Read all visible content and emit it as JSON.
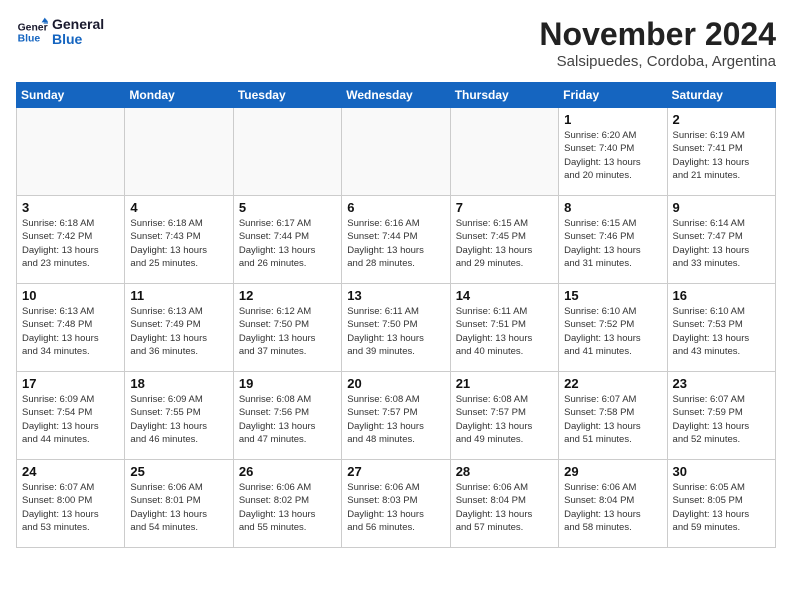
{
  "header": {
    "logo_line1": "General",
    "logo_line2": "Blue",
    "month_title": "November 2024",
    "location": "Salsipuedes, Cordoba, Argentina"
  },
  "days_of_week": [
    "Sunday",
    "Monday",
    "Tuesday",
    "Wednesday",
    "Thursday",
    "Friday",
    "Saturday"
  ],
  "weeks": [
    [
      {
        "day": "",
        "info": ""
      },
      {
        "day": "",
        "info": ""
      },
      {
        "day": "",
        "info": ""
      },
      {
        "day": "",
        "info": ""
      },
      {
        "day": "",
        "info": ""
      },
      {
        "day": "1",
        "info": "Sunrise: 6:20 AM\nSunset: 7:40 PM\nDaylight: 13 hours\nand 20 minutes."
      },
      {
        "day": "2",
        "info": "Sunrise: 6:19 AM\nSunset: 7:41 PM\nDaylight: 13 hours\nand 21 minutes."
      }
    ],
    [
      {
        "day": "3",
        "info": "Sunrise: 6:18 AM\nSunset: 7:42 PM\nDaylight: 13 hours\nand 23 minutes."
      },
      {
        "day": "4",
        "info": "Sunrise: 6:18 AM\nSunset: 7:43 PM\nDaylight: 13 hours\nand 25 minutes."
      },
      {
        "day": "5",
        "info": "Sunrise: 6:17 AM\nSunset: 7:44 PM\nDaylight: 13 hours\nand 26 minutes."
      },
      {
        "day": "6",
        "info": "Sunrise: 6:16 AM\nSunset: 7:44 PM\nDaylight: 13 hours\nand 28 minutes."
      },
      {
        "day": "7",
        "info": "Sunrise: 6:15 AM\nSunset: 7:45 PM\nDaylight: 13 hours\nand 29 minutes."
      },
      {
        "day": "8",
        "info": "Sunrise: 6:15 AM\nSunset: 7:46 PM\nDaylight: 13 hours\nand 31 minutes."
      },
      {
        "day": "9",
        "info": "Sunrise: 6:14 AM\nSunset: 7:47 PM\nDaylight: 13 hours\nand 33 minutes."
      }
    ],
    [
      {
        "day": "10",
        "info": "Sunrise: 6:13 AM\nSunset: 7:48 PM\nDaylight: 13 hours\nand 34 minutes."
      },
      {
        "day": "11",
        "info": "Sunrise: 6:13 AM\nSunset: 7:49 PM\nDaylight: 13 hours\nand 36 minutes."
      },
      {
        "day": "12",
        "info": "Sunrise: 6:12 AM\nSunset: 7:50 PM\nDaylight: 13 hours\nand 37 minutes."
      },
      {
        "day": "13",
        "info": "Sunrise: 6:11 AM\nSunset: 7:50 PM\nDaylight: 13 hours\nand 39 minutes."
      },
      {
        "day": "14",
        "info": "Sunrise: 6:11 AM\nSunset: 7:51 PM\nDaylight: 13 hours\nand 40 minutes."
      },
      {
        "day": "15",
        "info": "Sunrise: 6:10 AM\nSunset: 7:52 PM\nDaylight: 13 hours\nand 41 minutes."
      },
      {
        "day": "16",
        "info": "Sunrise: 6:10 AM\nSunset: 7:53 PM\nDaylight: 13 hours\nand 43 minutes."
      }
    ],
    [
      {
        "day": "17",
        "info": "Sunrise: 6:09 AM\nSunset: 7:54 PM\nDaylight: 13 hours\nand 44 minutes."
      },
      {
        "day": "18",
        "info": "Sunrise: 6:09 AM\nSunset: 7:55 PM\nDaylight: 13 hours\nand 46 minutes."
      },
      {
        "day": "19",
        "info": "Sunrise: 6:08 AM\nSunset: 7:56 PM\nDaylight: 13 hours\nand 47 minutes."
      },
      {
        "day": "20",
        "info": "Sunrise: 6:08 AM\nSunset: 7:57 PM\nDaylight: 13 hours\nand 48 minutes."
      },
      {
        "day": "21",
        "info": "Sunrise: 6:08 AM\nSunset: 7:57 PM\nDaylight: 13 hours\nand 49 minutes."
      },
      {
        "day": "22",
        "info": "Sunrise: 6:07 AM\nSunset: 7:58 PM\nDaylight: 13 hours\nand 51 minutes."
      },
      {
        "day": "23",
        "info": "Sunrise: 6:07 AM\nSunset: 7:59 PM\nDaylight: 13 hours\nand 52 minutes."
      }
    ],
    [
      {
        "day": "24",
        "info": "Sunrise: 6:07 AM\nSunset: 8:00 PM\nDaylight: 13 hours\nand 53 minutes."
      },
      {
        "day": "25",
        "info": "Sunrise: 6:06 AM\nSunset: 8:01 PM\nDaylight: 13 hours\nand 54 minutes."
      },
      {
        "day": "26",
        "info": "Sunrise: 6:06 AM\nSunset: 8:02 PM\nDaylight: 13 hours\nand 55 minutes."
      },
      {
        "day": "27",
        "info": "Sunrise: 6:06 AM\nSunset: 8:03 PM\nDaylight: 13 hours\nand 56 minutes."
      },
      {
        "day": "28",
        "info": "Sunrise: 6:06 AM\nSunset: 8:04 PM\nDaylight: 13 hours\nand 57 minutes."
      },
      {
        "day": "29",
        "info": "Sunrise: 6:06 AM\nSunset: 8:04 PM\nDaylight: 13 hours\nand 58 minutes."
      },
      {
        "day": "30",
        "info": "Sunrise: 6:05 AM\nSunset: 8:05 PM\nDaylight: 13 hours\nand 59 minutes."
      }
    ]
  ]
}
